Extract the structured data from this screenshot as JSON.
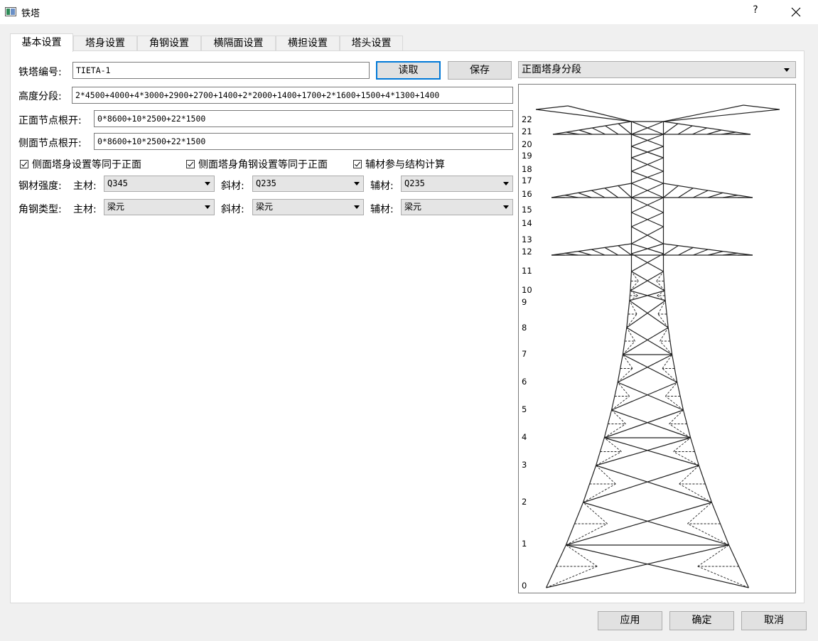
{
  "window": {
    "title": "铁塔",
    "help": "?"
  },
  "tabs": [
    {
      "label": "基本设置"
    },
    {
      "label": "塔身设置"
    },
    {
      "label": "角钢设置"
    },
    {
      "label": "横隔面设置"
    },
    {
      "label": "横担设置"
    },
    {
      "label": "塔头设置"
    }
  ],
  "form": {
    "tower_id_label": "铁塔编号:",
    "tower_id_value": "TIETA-1",
    "read_button": "读取",
    "save_button": "保存",
    "height_label": "高度分段:",
    "height_value": "2*4500+4000+4*3000+2900+2700+1400+2*2000+1400+1700+2*1600+1500+4*1300+1400",
    "front_label": "正面节点根开:",
    "front_value": "0*8600+10*2500+22*1500",
    "side_label": "侧面节点根开:",
    "side_value": "0*8600+10*2500+22*1500",
    "checkbox_side_same": "侧面塔身设置等同于正面",
    "checkbox_side_angle_same": "侧面塔身角钢设置等同于正面",
    "checkbox_aux_calc": "辅材参与结构计算",
    "steel_strength_label": "钢材强度:",
    "angle_type_label": "角钢类型:",
    "main_label": "主材:",
    "diag_label": "斜材:",
    "aux_label": "辅材:",
    "strength_main": "Q345",
    "strength_diag": "Q235",
    "strength_aux": "Q235",
    "type_main": "梁元",
    "type_diag": "梁元",
    "type_aux": "梁元"
  },
  "preview": {
    "view_select": "正面塔身分段",
    "segments": [
      "22",
      "21",
      "20",
      "19",
      "18",
      "17",
      "16",
      "15",
      "14",
      "13",
      "12",
      "11",
      "10",
      "9",
      "8",
      "7",
      "6",
      "5",
      "4",
      "3",
      "2",
      "1",
      "0"
    ]
  },
  "footer": {
    "apply": "应用",
    "ok": "确定",
    "cancel": "取消"
  },
  "colors": {
    "accent": "#0078d7",
    "panel": "#ffffff",
    "window": "#f0f0f0"
  }
}
